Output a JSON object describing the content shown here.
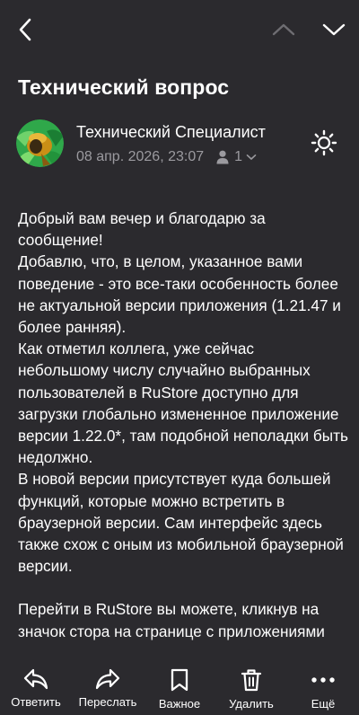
{
  "message": {
    "subject": "Технический вопрос",
    "sender_name": "Технический Специалист",
    "date": "08 апр. 2026, 23:07",
    "recipients_count": "1",
    "body_paragraphs": [
      "Добрый вам вечер и благодарю за сообщение!\nДобавлю, что, в целом, указанное вами поведение - это все-таки особенность более не актуальной версии приложения (1.21.47 и более ранняя).\nКак отметил коллега, уже сейчас небольшому числу случайно выбранных пользователей в RuStore доступно для загрузки глобально измененное приложение версии 1.22.0*, там подобной неполадки быть недолжно.\nВ новой версии присутствует куда большей функций, которые можно встретить в браузерной версии. Сам интерфейс здесь также схож с оным из мобильной браузерной версии.",
      "Перейти в RuStore вы можете, кликнув на значок стора на странице с приложениями"
    ]
  },
  "toolbar": {
    "items": [
      {
        "label": "Ответить",
        "icon": "reply-icon"
      },
      {
        "label": "Переслать",
        "icon": "forward-icon"
      },
      {
        "label": "Важное",
        "icon": "bookmark-icon"
      },
      {
        "label": "Удалить",
        "icon": "trash-icon"
      },
      {
        "label": "Ещё",
        "icon": "more-icon"
      }
    ]
  },
  "colors": {
    "background": "#2b2a2e",
    "text": "#ffffff",
    "secondary_text": "#9b9a9f",
    "disabled_icon": "#6e6d72",
    "avatar_green": "#2fa84a"
  }
}
